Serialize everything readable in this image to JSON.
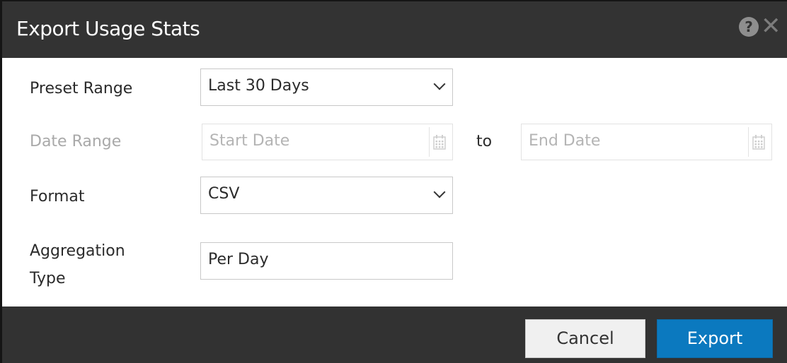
{
  "dialog": {
    "title": "Export Usage Stats",
    "help_icon": "question-circle-icon",
    "close_icon": "close-icon"
  },
  "form": {
    "preset_range": {
      "label": "Preset Range",
      "value": "Last 30 Days"
    },
    "date_range": {
      "label": "Date Range",
      "start_placeholder": "Start Date",
      "separator": "to",
      "end_placeholder": "End Date",
      "icon": "calendar-icon",
      "disabled": true
    },
    "format": {
      "label": "Format",
      "value": "CSV"
    },
    "aggregation": {
      "label_line1": "Aggregation",
      "label_line2": "Type",
      "value": "Per Day"
    }
  },
  "footer": {
    "cancel_label": "Cancel",
    "export_label": "Export"
  },
  "colors": {
    "titlebar": "#333333",
    "primary": "#0b79bf",
    "disabled_text": "#a9a9a9"
  }
}
